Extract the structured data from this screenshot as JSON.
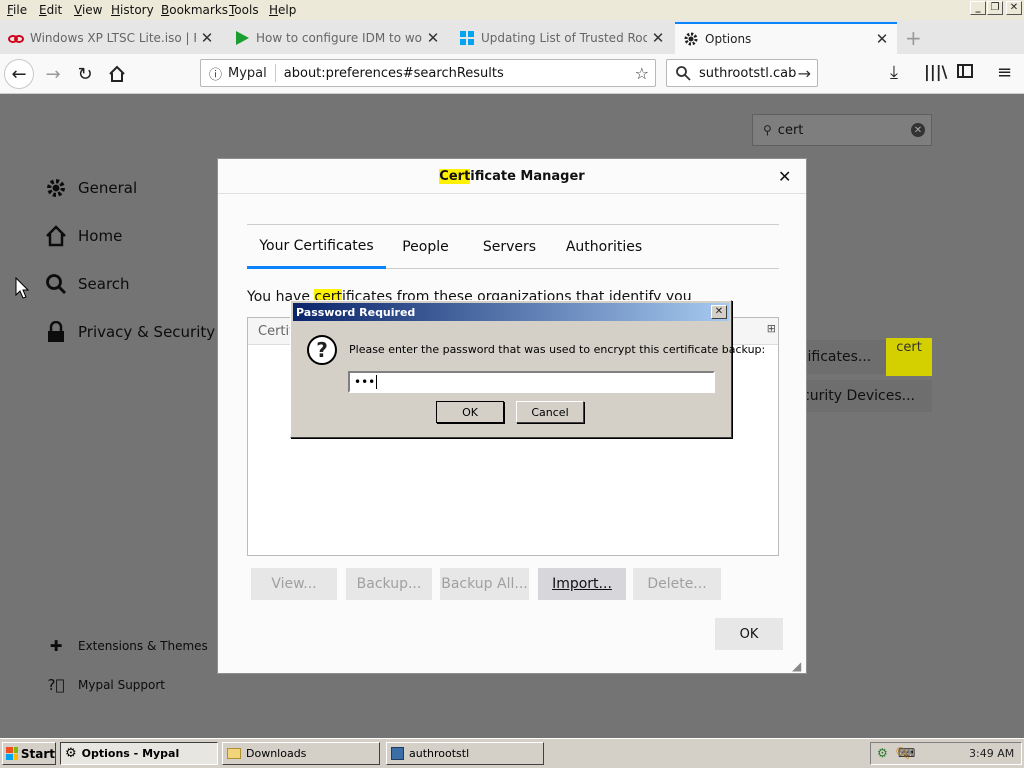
{
  "menubar": {
    "items": [
      "File",
      "Edit",
      "View",
      "History",
      "Bookmarks",
      "Tools",
      "Help"
    ]
  },
  "tabs": [
    {
      "title": "Windows XP LTSC Lite.iso | Files.fm",
      "favicon": "files-fm-icon"
    },
    {
      "title": "How to configure IDM to work with",
      "favicon": "play-icon"
    },
    {
      "title": "Updating List of Trusted Root Cert",
      "favicon": "windows-icon"
    },
    {
      "title": "Options",
      "favicon": "gear-icon"
    }
  ],
  "navbar": {
    "site_identity": "Mypal",
    "url": "about:preferences#searchResults",
    "search_value": "suthrootstl.cab"
  },
  "prefs": {
    "search_value": "cert",
    "sidebar": [
      "General",
      "Home",
      "Search",
      "Privacy & Security"
    ],
    "footer": [
      "Extensions & Themes",
      "Mypal Support"
    ],
    "bg_buttons": [
      "View Certificates...",
      "Security Devices..."
    ],
    "bg_buttons_visible": [
      "tificates...",
      "curity Devices..."
    ],
    "tooltip": "cert"
  },
  "certmgr": {
    "title_hl": "Cert",
    "title_rest": "ificate Manager",
    "tabs": [
      "Your Certificates",
      "People",
      "Servers",
      "Authorities"
    ],
    "desc_pre": "You have ",
    "desc_hl": "cert",
    "desc_post": "ificates from these organizations that identify you",
    "col_header": "Certifi",
    "buttons": [
      "View...",
      "Backup...",
      "Backup All...",
      "Import...",
      "Delete..."
    ],
    "ok": "OK"
  },
  "password_dialog": {
    "title": "Password Required",
    "message": "Please enter the password that was used to encrypt this certificate backup:",
    "password_value": "•••",
    "ok": "OK",
    "cancel": "Cancel"
  },
  "taskbar": {
    "start": "Start",
    "tasks": [
      "Options - Mypal",
      "Downloads",
      "authrootstl"
    ],
    "clock": "3:49 AM"
  },
  "colors": {
    "accent": "#0a84ff",
    "highlight": "#fff200",
    "title_bar": "#0a246a"
  }
}
